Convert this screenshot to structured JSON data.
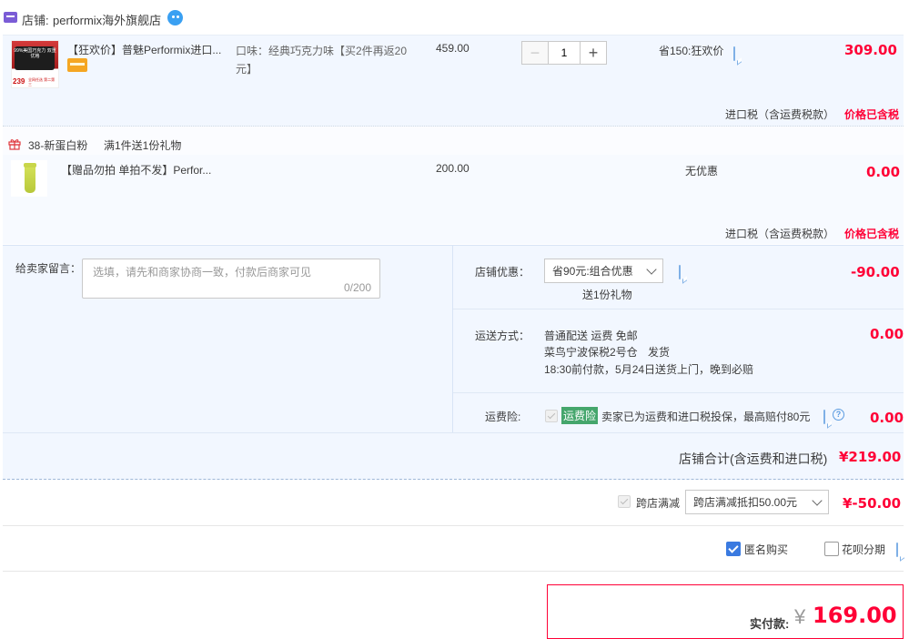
{
  "shop": {
    "label": "店铺:",
    "name": "performix海外旗舰店"
  },
  "item1": {
    "title": "【狂欢价】普魅Performix进口...",
    "sku": "口味：经典巧克力味【买2件再返20元】",
    "unit_price": "459.00",
    "quantity": "1",
    "discount": "省150:狂欢价",
    "subtotal": "309.00",
    "image_text_top": "99%美国巧克力 双重优格",
    "image_text_price": "239",
    "image_text_bottom": "全网任选 第二第三"
  },
  "tax_note_1": {
    "label": "进口税（含运费税款）",
    "value": "价格已含税"
  },
  "gift_promo": {
    "title": "38-新蛋白粉",
    "rule": "满1件送1份礼物"
  },
  "item2": {
    "title": "【赠品勿拍 单拍不发】Perfor...",
    "unit_price": "200.00",
    "discount": "无优惠",
    "subtotal": "0.00"
  },
  "tax_note_2": {
    "label": "进口税（含运费税款）",
    "value": "价格已含税"
  },
  "message": {
    "label": "给卖家留言：",
    "placeholder": "选填，请先和商家协商一致，付款后商家可见",
    "counter": "0/200"
  },
  "shop_discount": {
    "label": "店铺优惠：",
    "selected": "省90元:组合优惠",
    "gift_text": "送1份礼物",
    "amount": "-90.00"
  },
  "shipping": {
    "label": "运送方式：",
    "line1": "普通配送 运费 免邮",
    "warehouse": "菜鸟宁波保税2号仓",
    "ship_text": "发货",
    "line3": "18:30前付款，5月24日送货上门，晚到必赔",
    "amount": "0.00"
  },
  "insurance": {
    "label": "运费险:",
    "badge": "运费险",
    "text": "卖家已为运费和进口税投保，最高赔付80元",
    "amount": "0.00"
  },
  "shop_total": {
    "label": "店铺合计(含运费和进口税)",
    "amount": "¥219.00"
  },
  "cross_store": {
    "label": "跨店满减",
    "selected": "跨店满减抵扣50.00元",
    "amount": "¥-50.00"
  },
  "options": {
    "anonymous_label": "匿名购买",
    "installment_label": "花呗分期"
  },
  "payment": {
    "label": "实付款:",
    "currency": "¥",
    "amount": "169.00"
  },
  "colors": {
    "accent_red": "#ff0036",
    "panel_blue": "#f2f7ff",
    "border_blue": "#b2d1ff",
    "badge_green": "#45a66c"
  }
}
